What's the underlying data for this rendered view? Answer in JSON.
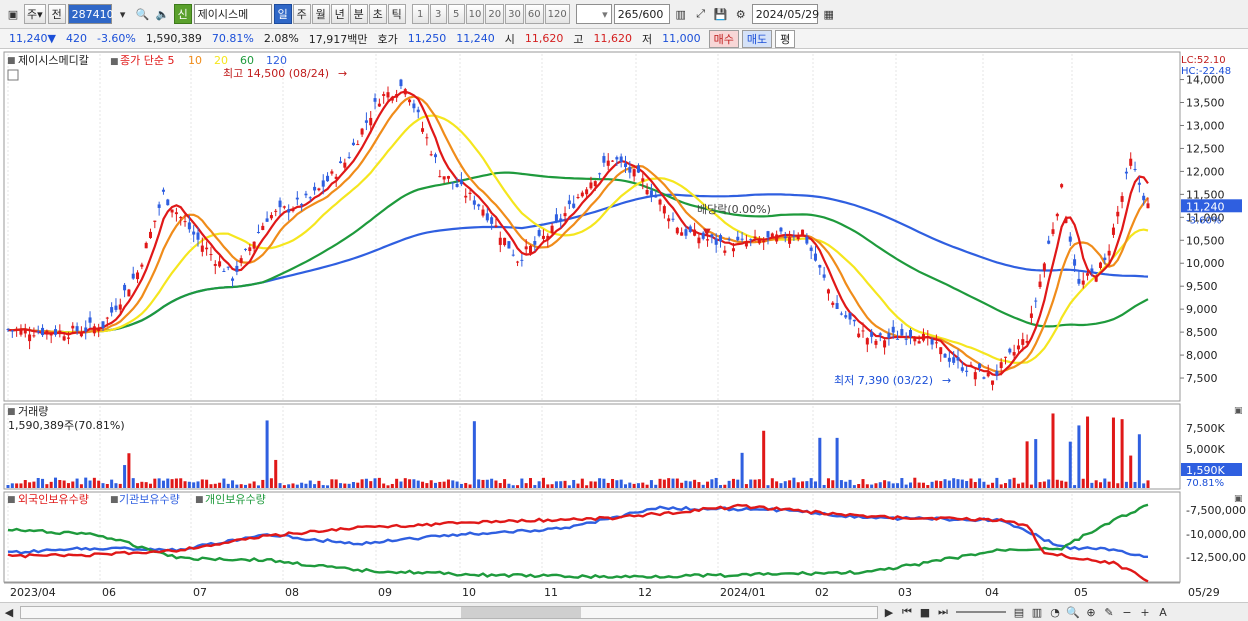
{
  "toolbar": {
    "type_label": "주",
    "prev_label": "전",
    "code": "287410",
    "shin_label": "신",
    "name": "제이시스메",
    "periods": [
      "일",
      "주",
      "월",
      "년",
      "분",
      "초",
      "틱"
    ],
    "active_period": "일",
    "intervals": [
      "1",
      "3",
      "5",
      "10",
      "20",
      "30",
      "60",
      "120"
    ],
    "count": "265",
    "count_total": "/600",
    "date": "2024/05/29"
  },
  "quote": {
    "price": "11,240",
    "arrow": "▼",
    "change": "420",
    "change_pct": "-3.60%",
    "volume": "1,590,389",
    "volume_ratio": "70.81%",
    "turnover": "2.08%",
    "amount": "17,917백만",
    "hoga_label": "호가",
    "ask": "11,250",
    "bid": "11,240",
    "open_label": "시",
    "open": "11,620",
    "high_label": "고",
    "high": "11,620",
    "low_label": "저",
    "low": "11,000",
    "buy_label": "매수",
    "sell_label": "매도",
    "eval_label": "평"
  },
  "price_panel": {
    "stock_name": "제이시스메디칼",
    "ma_label": "종가 단순",
    "ma_periods": [
      "5",
      "10",
      "20",
      "60",
      "120"
    ],
    "max_label": "최고 14,500 (08/24)",
    "min_label": "최저 7,390 (03/22)",
    "dividend_label": "배당락(0.00%)",
    "lc": "LC:52.10",
    "hc": "HC:-22.48",
    "y_ticks": [
      "14,000",
      "13,500",
      "13,000",
      "12,500",
      "12,000",
      "11,500",
      "11,000",
      "10,500",
      "10,000",
      "9,500",
      "9,000",
      "8,500",
      "8,000",
      "7,500"
    ],
    "current_tag": "11,240",
    "current_pct": "-3.60%"
  },
  "volume_panel": {
    "title": "거래량",
    "info": "1,590,389주(70.81%)",
    "y_ticks": [
      "7,500K",
      "5,000K"
    ],
    "current_tag": "1,590K",
    "current_pct": "70.81%"
  },
  "holder_panel": {
    "foreign": "외국인보유수량",
    "inst": "기관보유수량",
    "indiv": "개인보유수량",
    "y_ticks": [
      "-7,500,000",
      "-10,000,00",
      "-12,500,00"
    ]
  },
  "x_axis": [
    "2023/04",
    "06",
    "07",
    "08",
    "09",
    "10",
    "11",
    "12",
    "2024/01",
    "02",
    "03",
    "04",
    "05",
    "05/29"
  ],
  "colors": {
    "ma5": "#e01818",
    "ma10": "#f08c1a",
    "ma20": "#f5e61e",
    "ma60": "#1e9a3c",
    "ma120": "#2f5fe0",
    "up": "#e01818",
    "down": "#2f5fe0",
    "foreign": "#2f5fe0",
    "inst": "#1e9a3c",
    "indiv": "#e01818"
  }
}
